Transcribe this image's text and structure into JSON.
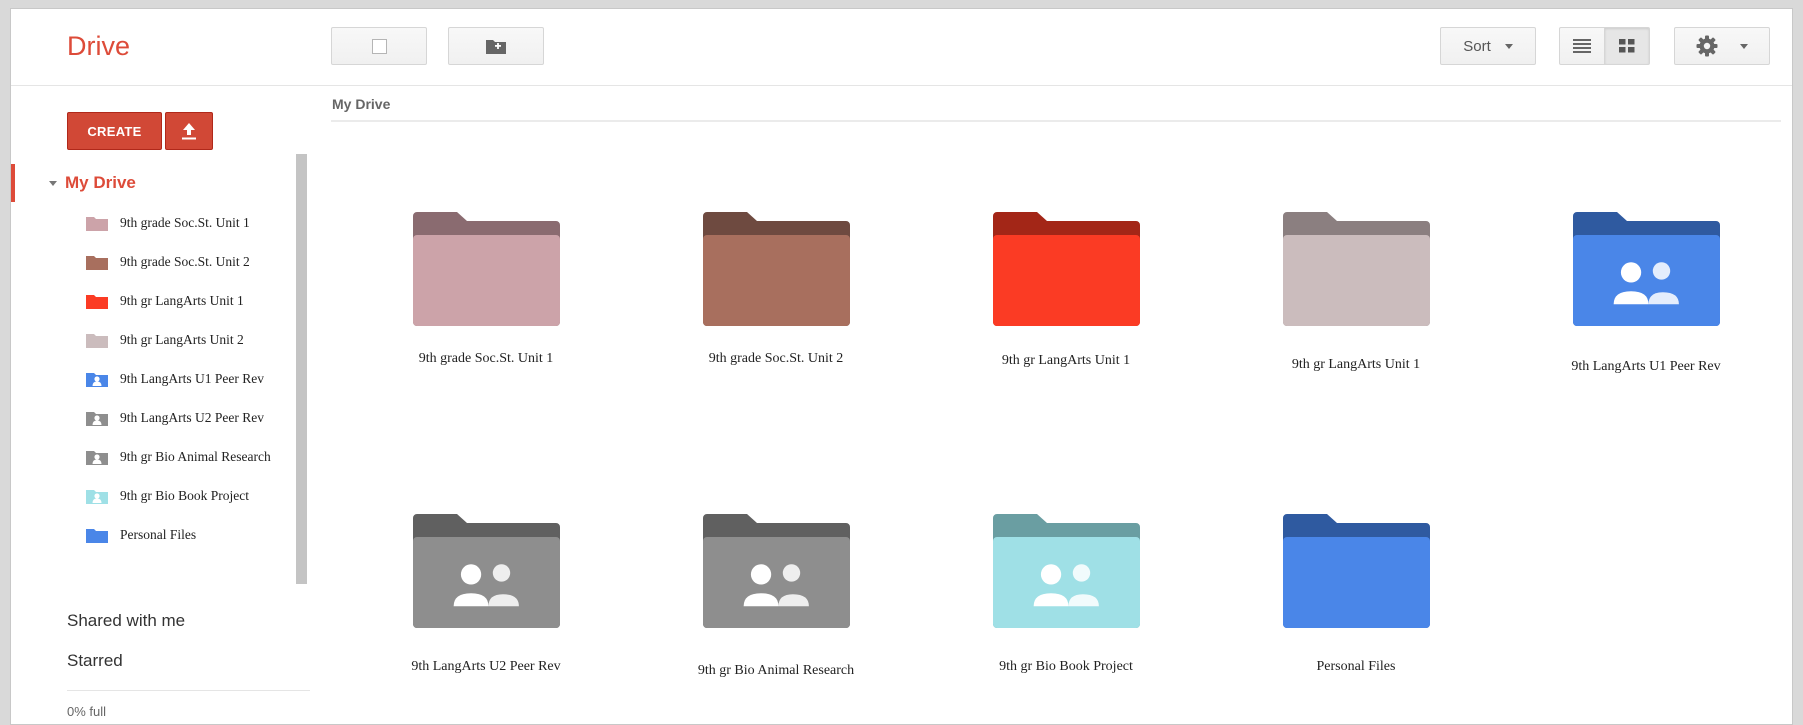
{
  "app": {
    "title": "Drive"
  },
  "toolbar": {
    "sort_label": "Sort"
  },
  "sidebar": {
    "create_label": "CREATE",
    "my_drive_label": "My Drive",
    "items": [
      {
        "label": "9th grade Soc.St. Unit 1",
        "color": "#cca3a9",
        "shared": false
      },
      {
        "label": "9th grade Soc.St. Unit 2",
        "color": "#a86f5e",
        "shared": false
      },
      {
        "label": "9th gr LangArts Unit 1",
        "color": "#fb3b24",
        "shared": false
      },
      {
        "label": "9th gr LangArts Unit 2",
        "color": "#cbbcbd",
        "shared": false
      },
      {
        "label": "9th  LangArts U1 Peer Rev",
        "color": "#4a86e8",
        "shared": true
      },
      {
        "label": "9th  LangArts U2 Peer Rev",
        "color": "#8e8e8e",
        "shared": true
      },
      {
        "label": "9th gr Bio Animal Research",
        "color": "#8e8e8e",
        "shared": true
      },
      {
        "label": "9th gr Bio Book Project",
        "color": "#9fe0e6",
        "shared": true
      },
      {
        "label": "Personal Files",
        "color": "#4a86e8",
        "shared": false
      }
    ],
    "shared_label": "Shared with me",
    "starred_label": "Starred",
    "quota_label": "0% full"
  },
  "main": {
    "breadcrumb": "My Drive",
    "folders": [
      {
        "label": "9th grade Soc.St. Unit 1",
        "color": "#cca3a9",
        "tab": "#8a6b70",
        "shared": false
      },
      {
        "label": "9th grade Soc.St. Unit 2",
        "color": "#a86f5e",
        "tab": "#6e4a40",
        "shared": false
      },
      {
        "label": "9th gr LangArts Unit 1",
        "color": "#fb3b24",
        "tab": "#a32617",
        "shared": false
      },
      {
        "label": "9th gr LangArts Unit 1",
        "color": "#cbbcbd",
        "tab": "#8b7f80",
        "shared": false
      },
      {
        "label": "9th  LangArts U1 Peer Rev",
        "color": "#4a86e8",
        "tab": "#2f5aa0",
        "shared": true
      },
      {
        "label": "9th  LangArts U2 Peer Rev",
        "color": "#8e8e8e",
        "tab": "#606060",
        "shared": true
      },
      {
        "label": "9th gr Bio Animal Research",
        "color": "#8e8e8e",
        "tab": "#606060",
        "shared": true
      },
      {
        "label": "9th gr Bio Book Project",
        "color": "#9fe0e6",
        "tab": "#6a9ea2",
        "shared": true
      },
      {
        "label": "Personal Files",
        "color": "#4a86e8",
        "tab": "#2f5aa0",
        "shared": false
      }
    ]
  },
  "colors": {
    "accent": "#dd4b39",
    "create_button": "#d14836"
  }
}
